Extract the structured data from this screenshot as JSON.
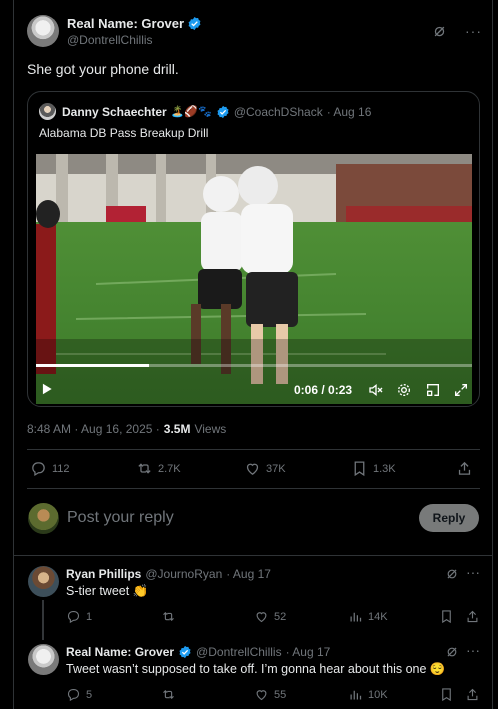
{
  "main_tweet": {
    "display_name": "Real Name: Grover",
    "handle": "@DontrellChillis",
    "text": "She got your phone drill.",
    "timestamp": "8:48 AM · Aug 16, 2025 ·",
    "views_count": "3.5M",
    "views_label": "Views",
    "stats": {
      "replies": "112",
      "reposts": "2.7K",
      "likes": "37K",
      "bookmarks": "1.3K"
    }
  },
  "quoted_tweet": {
    "display_name": "Danny Schaechter",
    "emojis": "🏝️🏈🐾",
    "handle": "@CoachDShack",
    "date": "· Aug 16",
    "text": "Alabama DB Pass Breakup Drill",
    "video": {
      "time": "0:06 / 0:23",
      "progress": 0.26
    }
  },
  "reply_box": {
    "placeholder": "Post your reply",
    "button_label": "Reply"
  },
  "replies": [
    {
      "display_name": "Ryan Phillips",
      "handle": "@JournoRyan",
      "date": "· Aug 17",
      "text": "S-tier tweet 👏",
      "stats": {
        "replies": "1",
        "reposts": "",
        "likes": "52",
        "views": "14K"
      }
    },
    {
      "display_name": "Real Name: Grover",
      "handle": "@DontrellChillis",
      "date": "· Aug 17",
      "text": "Tweet wasn’t supposed to take off. I’m gonna hear about this one 😌",
      "stats": {
        "replies": "5",
        "reposts": "",
        "likes": "55",
        "views": "10K"
      }
    }
  ],
  "colors": {
    "background": "#000000",
    "text": "#e7e9ea",
    "muted": "#71767b",
    "verified": "#1d9bf0",
    "border": "#2f3336"
  }
}
